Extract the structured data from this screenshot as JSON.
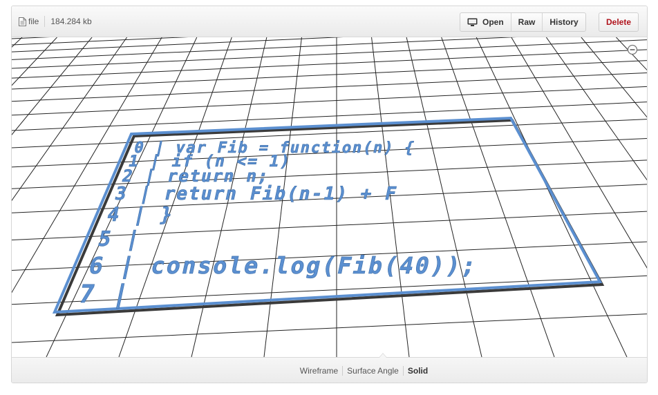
{
  "header": {
    "file_label": "file",
    "file_size": "184.284 kb",
    "buttons": [
      {
        "label": "Open",
        "icon": "monitor-icon"
      },
      {
        "label": "Raw"
      },
      {
        "label": "History"
      }
    ],
    "delete_label": "Delete"
  },
  "viewer": {
    "code_lines": [
      "0 | var Fib = function(n) {",
      "1 |     if (n <= 1)",
      "2 |         return n;",
      "3 |     return Fib(n-1) + F",
      "4 | }",
      "5 |",
      "6 | console.log(Fib(40));",
      "7 |"
    ],
    "colors": {
      "model": "#5b8fd0",
      "model_dark": "#3d6ea8",
      "grid": "#222222",
      "outline_shadow": "#3a3a3a"
    }
  },
  "footer": {
    "modes": [
      "Wireframe",
      "Surface Angle",
      "Solid"
    ],
    "active_mode": "Solid"
  },
  "colors": {
    "delete_text": "#b0131c"
  }
}
